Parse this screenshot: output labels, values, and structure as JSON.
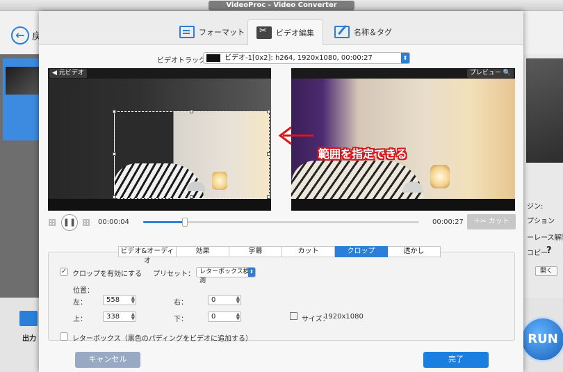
{
  "window": {
    "title": "VideoProc - Video Converter"
  },
  "background": {
    "back_label": "戻",
    "output_label": "出力",
    "run_label": "RUN",
    "right_labels": [
      "ジン:",
      "プション",
      "ーレース解除",
      "コピー",
      "?"
    ],
    "open_label": "開く"
  },
  "tabs": [
    {
      "label": "フォーマット",
      "icon": "format-icon"
    },
    {
      "label": "ビデオ編集",
      "icon": "video-edit-icon",
      "active": true
    },
    {
      "label": "名称＆タグ",
      "icon": "tag-icon"
    }
  ],
  "track": {
    "label": "ビデオトラック：",
    "value": "ビデオ-1[0x2]: h264, 1920x1080, 00:00:27"
  },
  "preview": {
    "source_label": "◀ 元ビデオ",
    "preview_label": "プレビュー 🔍"
  },
  "annotation": {
    "text": "範囲を指定できる",
    "color": "#d8161c"
  },
  "playback": {
    "current_time": "00:00:04",
    "end_time": "00:00:27",
    "progress": 0.15,
    "cut_label": "＋✂ カット"
  },
  "subtabs": [
    {
      "label": "ビデオ&オーディオ"
    },
    {
      "label": "効果"
    },
    {
      "label": "字幕"
    },
    {
      "label": "カット"
    },
    {
      "label": "クロップ",
      "active": true
    },
    {
      "label": "透かし"
    }
  ],
  "crop": {
    "enable_label": "クロップを有効にする",
    "enable_checked": true,
    "preset_label": "プリセット：",
    "preset_value": "レターボックス検測",
    "position_label": "位置：",
    "left_label": "左：",
    "left_value": "558",
    "right_label": "右：",
    "right_value": "0",
    "top_label": "上：",
    "top_value": "338",
    "bottom_label": "下：",
    "bottom_value": "0",
    "size_label": "サイズ：",
    "size_value": "1920x1080",
    "letterbox_label": "レターボックス（黒色のパディングをビデオに追加する）",
    "letterbox_checked": false
  },
  "buttons": {
    "cancel": "キャンセル",
    "done": "完了"
  },
  "colors": {
    "accent": "#2a7fd8",
    "done": "#1a7fe0",
    "cancel": "#99a9c4"
  }
}
